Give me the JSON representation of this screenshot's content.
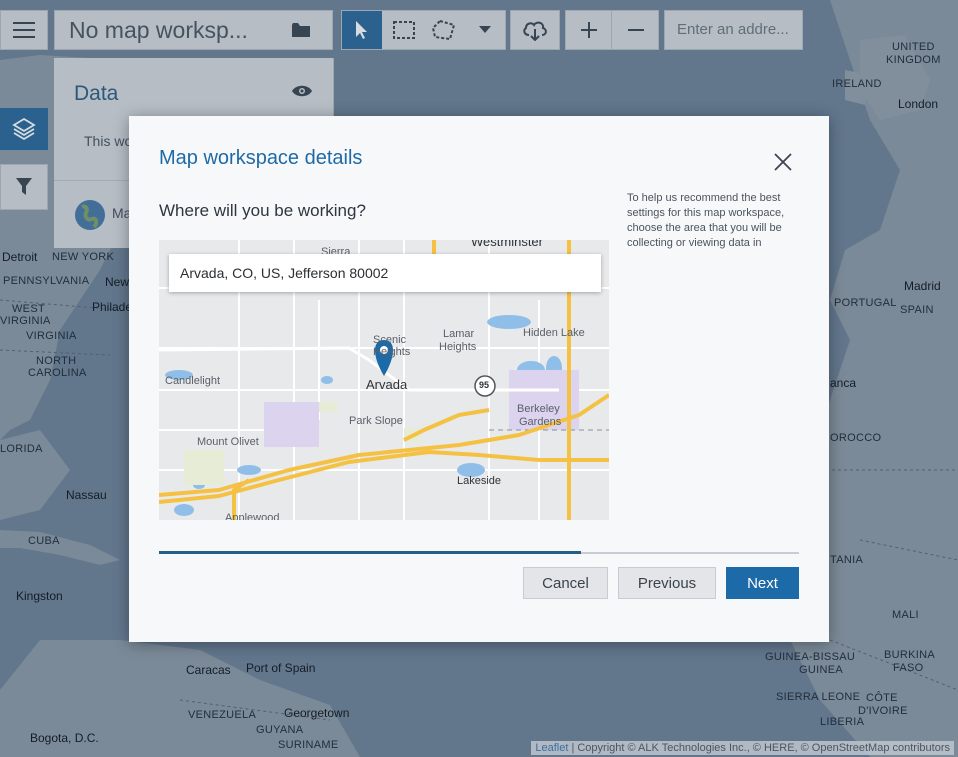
{
  "toolbar": {
    "workspace_title": "No map worksp...",
    "address_placeholder": "Enter an addre..."
  },
  "side_panel": {
    "title": "Data",
    "body_text": "This wo",
    "bottom_text": "Ma"
  },
  "background_map": {
    "labels": [
      {
        "text": "UNITED",
        "kind": "country"
      },
      {
        "text": "KINGDOM",
        "kind": "country"
      },
      {
        "text": "IRELAND",
        "kind": "country"
      },
      {
        "text": "London",
        "kind": "city"
      },
      {
        "text": "Detroit",
        "kind": "city"
      },
      {
        "text": "NEW YORK",
        "kind": "country"
      },
      {
        "text": "PENNSYLVANIA",
        "kind": "country"
      },
      {
        "text": "New",
        "kind": "city"
      },
      {
        "text": "Philade",
        "kind": "city"
      },
      {
        "text": "WEST",
        "kind": "country"
      },
      {
        "text": "VIRGINIA",
        "kind": "country"
      },
      {
        "text": "VIRGINIA",
        "kind": "country"
      },
      {
        "text": "NORTH",
        "kind": "country"
      },
      {
        "text": "CAROLINA",
        "kind": "country"
      },
      {
        "text": "LORIDA",
        "kind": "country"
      },
      {
        "text": "Nassau",
        "kind": "city"
      },
      {
        "text": "CUBA",
        "kind": "country"
      },
      {
        "text": "Kingston",
        "kind": "city"
      },
      {
        "text": "Caracas",
        "kind": "city"
      },
      {
        "text": "Port of Spain",
        "kind": "city"
      },
      {
        "text": "VENEZUELA",
        "kind": "country"
      },
      {
        "text": "Georgetown",
        "kind": "city"
      },
      {
        "text": "GUYANA",
        "kind": "country"
      },
      {
        "text": "SURINAME",
        "kind": "country"
      },
      {
        "text": "Bogota, D.C.",
        "kind": "city"
      },
      {
        "text": "Madrid",
        "kind": "city"
      },
      {
        "text": "SPAIN",
        "kind": "country"
      },
      {
        "text": "PORTUGAL",
        "kind": "country"
      },
      {
        "text": "OROCCO",
        "kind": "country"
      },
      {
        "text": "anca",
        "kind": "city"
      },
      {
        "text": "TANIA",
        "kind": "country"
      },
      {
        "text": "MALI",
        "kind": "country"
      },
      {
        "text": "BURKINA",
        "kind": "country"
      },
      {
        "text": "FASO",
        "kind": "country"
      },
      {
        "text": "GUINEA-BISSAU",
        "kind": "country"
      },
      {
        "text": "GUINEA",
        "kind": "country"
      },
      {
        "text": "SIERRA LEONE",
        "kind": "country"
      },
      {
        "text": "CÔTE",
        "kind": "country"
      },
      {
        "text": "D'IVOIRE",
        "kind": "country"
      },
      {
        "text": "LIBERIA",
        "kind": "country"
      },
      {
        "text": "SPAIN",
        "kind": "country"
      }
    ]
  },
  "attribution": {
    "leaflet": "Leaflet",
    "rest": " | Copyright © ALK Technologies Inc., © HERE, © OpenStreetMap contributors"
  },
  "modal": {
    "title": "Map workspace details",
    "question": "Where will you be working?",
    "help_text": "To help us recommend the best settings for this map workspace, choose the area that you will be collecting or viewing data in",
    "address_value": "Arvada, CO, US, Jefferson 80002",
    "progress_fraction": 0.66,
    "map_labels": {
      "westminster": "Westminster",
      "sierra": "Sierra",
      "scenic": "Scenic",
      "heights": "Heights",
      "lamar": "Lamar",
      "lamar_heights": "Heights",
      "hidden_lake": "Hidden Lake",
      "candlelight": "Candlelight",
      "arvada": "Arvada",
      "route": "95",
      "berkeley": "Berkeley",
      "gardens": "Gardens",
      "park_slope": "Park Slope",
      "mount_olivet": "Mount Olivet",
      "lakeside": "Lakeside",
      "applewood": "Applewood"
    },
    "buttons": {
      "cancel": "Cancel",
      "previous": "Previous",
      "next": "Next"
    }
  },
  "colors": {
    "accent": "#1d6aa8",
    "title": "#1f6aa5",
    "progress": "#245f86",
    "highway": "#f5c143",
    "water": "#8fbfe8"
  }
}
